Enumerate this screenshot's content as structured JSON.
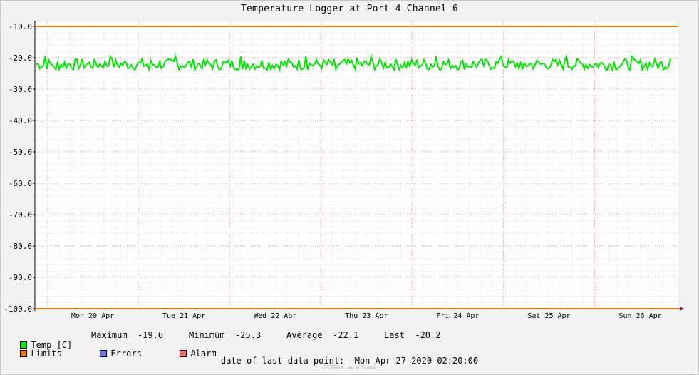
{
  "title": "Temperature Logger at Port 4 Channel 6",
  "chart_data": {
    "type": "line",
    "title": "Temperature Logger at Port 4 Channel 6",
    "ylim": [
      -100.0,
      -10.0
    ],
    "y_ticks": [
      "-10.0",
      "-20.0",
      "-30.0",
      "-40.0",
      "-50.0",
      "-60.0",
      "-70.0",
      "-80.0",
      "-90.0",
      "-100.0"
    ],
    "x_ticks": [
      "Mon 20 Apr",
      "Tue 21 Apr",
      "Wed 22 Apr",
      "Thu 23 Apr",
      "Fri 24 Apr",
      "Sat 25 Apr",
      "Sun 26 Apr"
    ],
    "grid": true,
    "series": [
      {
        "name": "Temp [C]",
        "color": "#00e800",
        "min": -25.3,
        "max": -19.6,
        "average": -22.1,
        "last": -20.2
      },
      {
        "name": "Limits",
        "color": "#f07800",
        "values": [
          -10.0,
          -100.0
        ]
      },
      {
        "name": "Errors",
        "color": "#6a78f0"
      },
      {
        "name": "Alarm",
        "color": "#f07070"
      }
    ]
  },
  "legend": {
    "temp_label": "Temp [C]",
    "maximum_label": "Maximum",
    "maximum_value": "-19.6",
    "minimum_label": "Minimum",
    "minimum_value": "-25.3",
    "average_label": "Average",
    "average_value": "-22.1",
    "last_label": "Last",
    "last_value": "-20.2",
    "limits_label": "Limits",
    "errors_label": "Errors",
    "alarm_label": "Alarm"
  },
  "footer": {
    "label": "date of last data point:",
    "value": "Mon Apr 27 2020 02:20:00"
  },
  "watermark": "OCTA&A Log & Guard"
}
